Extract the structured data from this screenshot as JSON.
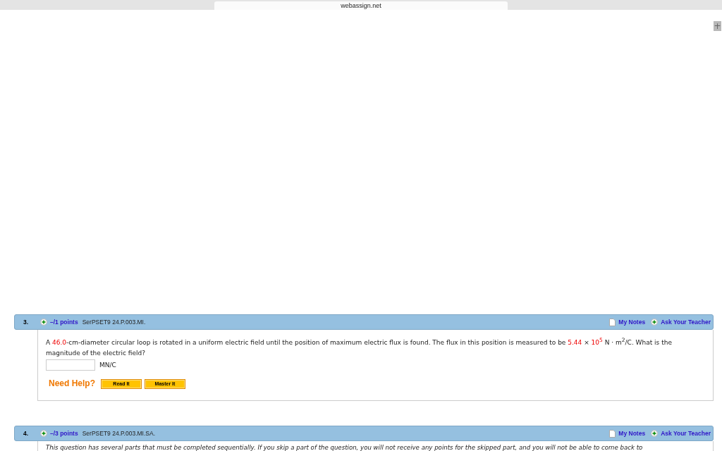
{
  "browser": {
    "address": "webassign.net",
    "new_tab": "+"
  },
  "questions": [
    {
      "number": "3.",
      "points": "–/1 points",
      "code": "SerPSET9 24.P.003.MI.",
      "notes": "My Notes",
      "ask": "Ask Your Teacher",
      "prompt": [
        {
          "kind": "text",
          "text": "A "
        },
        {
          "kind": "given",
          "text": "46.0"
        },
        {
          "kind": "text",
          "text": "-cm-diameter circular loop is rotated in a uniform electric field until the position of maximum electric flux is found. The flux in this position is measured to be "
        },
        {
          "kind": "given",
          "text": "5.44"
        },
        {
          "kind": "text",
          "text": " × "
        },
        {
          "kind": "given",
          "text": "10$^{5}$"
        },
        {
          "kind": "text",
          "text": " N · m$^{2}$/C. What is the magnitude of the electric field?"
        }
      ],
      "unit": "MN/C",
      "help": {
        "label": "Need Help?",
        "buttons": [
          "Read It",
          "Master It"
        ]
      }
    },
    {
      "number": "4.",
      "points": "–/3 points",
      "code": "SerPSET9 24.P.003.MI.SA.",
      "notes": "My Notes",
      "ask": "Ask Your Teacher",
      "intro": "This question has several parts that must be completed sequentially. If you skip a part of the question, you will not receive any points for the skipped part, and you will not be able to come back to"
    }
  ]
}
